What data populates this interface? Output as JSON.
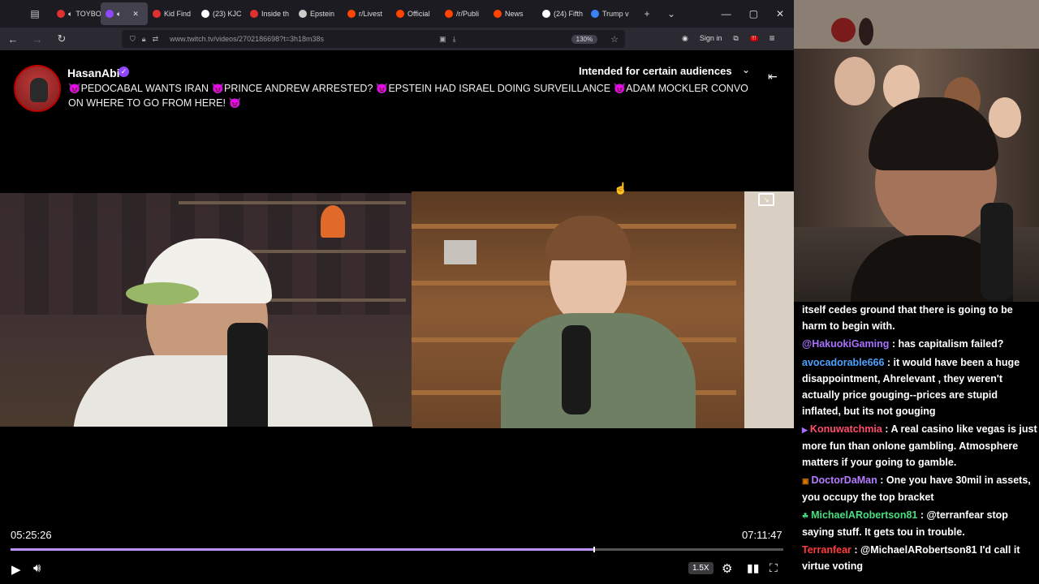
{
  "browser": {
    "tabs": [
      {
        "label": "TOYBO",
        "color": "#e03131"
      },
      {
        "label": "",
        "color": "#9147ff",
        "active": true
      },
      {
        "label": "Kid Find",
        "color": "#e03131"
      },
      {
        "label": "(23) KJC",
        "color": "#ffffff",
        "icon": "X"
      },
      {
        "label": "Inside th",
        "color": "#e03131"
      },
      {
        "label": "Epstein",
        "color": "#cccccc"
      },
      {
        "label": "r/Livest",
        "color": "#ff4500"
      },
      {
        "label": "Official",
        "color": "#ff4500"
      },
      {
        "label": "/r/Publi",
        "color": "#ff4500"
      },
      {
        "label": "News",
        "color": "#ff4500"
      },
      {
        "label": "(24) Fifth",
        "color": "#ffffff",
        "icon": "X"
      },
      {
        "label": "Trump v",
        "color": "#3b82f6"
      }
    ],
    "url": "www.twitch.tv/videos/2702186698?t=3h18m38s",
    "zoom": "130%",
    "sign_in": "Sign in",
    "notif_count": "!!!"
  },
  "stream": {
    "channel": "HasanAbi",
    "title": "😈PEDOCABAL WANTS IRAN 😈PRINCE ANDREW ARRESTED? 😈EPSTEIN HAD ISRAEL DOING SURVEILLANCE 😈ADAM MOCKLER CONVO ON WHERE TO GO FROM HERE! 😈",
    "audience": "Intended for certain audiences"
  },
  "player": {
    "current_time": "05:25:26",
    "total_time": "07:11:47",
    "progress_fraction": 0.754,
    "speed": "1.5X"
  },
  "chat": [
    {
      "user": "",
      "user_color": "#ffffff",
      "text": "itself cedes ground that there is going to be harm to begin with."
    },
    {
      "user": "@HakuokiGaming",
      "user_color": "#a970ff",
      "text": " : has capitalism failed?"
    },
    {
      "user": "avocadorable666",
      "user_color": "#4aa3ff",
      "text": " : it would have been a huge disappointment, Ahrelevant , they weren't actually price gouging--prices are stupid inflated, but its not gouging"
    },
    {
      "user": "Konuwatchmia",
      "user_color": "#ff4d6d",
      "badge": "▶",
      "text": " : A real casino like vegas is just more fun than onlone gambling. Atmosphere matters if your going to gamble."
    },
    {
      "user": "DoctorDaMan",
      "user_color": "#b57cff",
      "badge": "▣",
      "text": " : One you have 30mil in assets, you occupy the top bracket"
    },
    {
      "user": "MichaelARobertson81",
      "user_color": "#4ade80",
      "badge": "☘",
      "text": " : @terranfear stop saying stuff. It gets tou in trouble."
    },
    {
      "user": "Terranfear",
      "user_color": "#ff3b3b",
      "text": " : @MichaelARobertson81 I'd call it virtue voting"
    }
  ]
}
